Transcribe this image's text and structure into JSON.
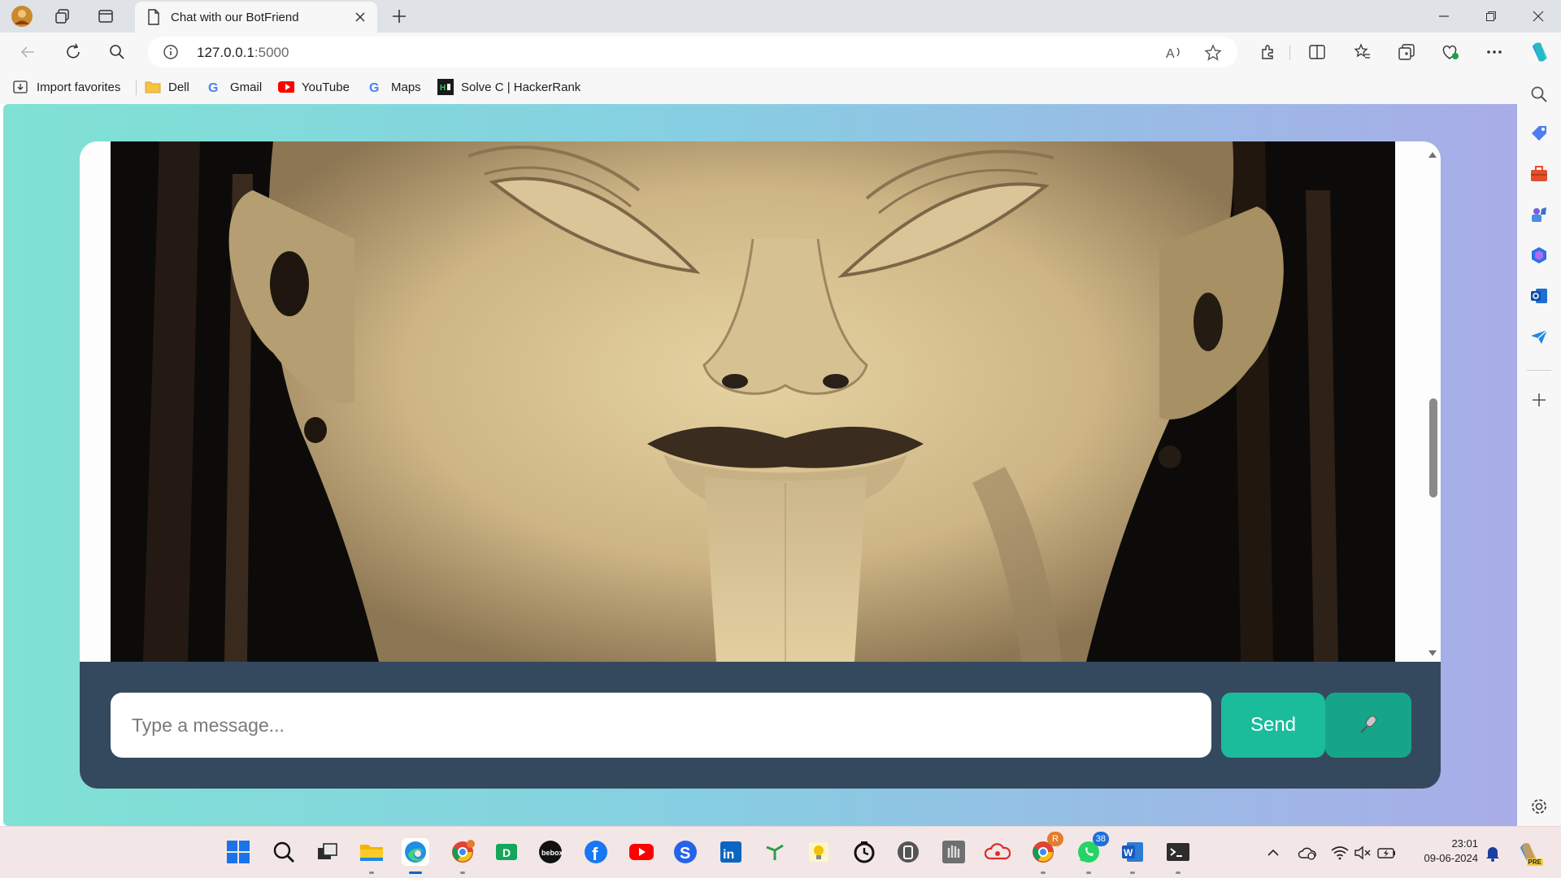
{
  "browser": {
    "tab_title": "Chat with our BotFriend",
    "url_host": "127.0.0.1",
    "url_port": ":5000"
  },
  "favorites": [
    {
      "label": "Import favorites",
      "icon": "import-icon"
    },
    {
      "label": "Dell",
      "icon": "folder-icon"
    },
    {
      "label": "Gmail",
      "icon": "google-icon"
    },
    {
      "label": "YouTube",
      "icon": "youtube-icon"
    },
    {
      "label": "Maps",
      "icon": "google-icon"
    },
    {
      "label": "Solve C | HackerRank",
      "icon": "hackerrank-icon"
    }
  ],
  "chat": {
    "input_placeholder": "Type a message...",
    "send_label": "Send",
    "mic_icon": "microphone-icon",
    "media_description_icon": "clay-sculpture-image"
  },
  "taskbar": {
    "whatsapp_badge": "38",
    "chrome_badge": "R",
    "time": "23:01",
    "date": "09-06-2024",
    "copilot_tag": "PRE"
  },
  "colors": {
    "input_bar": "#34495e",
    "send_button": "#1abc9c",
    "mic_button": "#17a589",
    "gradient_start": "#7fe2d4",
    "gradient_end": "#a9ace8"
  }
}
